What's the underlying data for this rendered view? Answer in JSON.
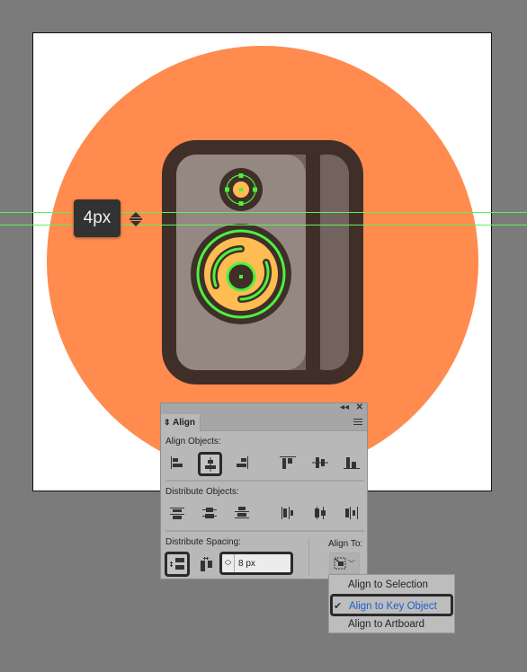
{
  "canvas": {
    "background_color": "#7b7b7b",
    "artboard_color": "#ffffff",
    "circle_color": "#ff8b4f",
    "guide_color": "#5ef25a"
  },
  "illustration": {
    "subject": "speaker",
    "outline_color": "#402f28",
    "front_color": "#958781",
    "side_color": "#73635f",
    "cone_color": "#ffbc52",
    "selection_color": "#4bf23e"
  },
  "measurement": {
    "label": "4px",
    "icon": "vertical-distance-icon"
  },
  "align_panel": {
    "collapse_icon": "double-chevron-left-icon",
    "close_icon": "close-icon",
    "tab_label": "Align",
    "tab_icon": "updown-arrows-icon",
    "menu_icon": "hamburger-menu-icon",
    "align_objects_label": "Align Objects:",
    "align_objects_buttons": [
      {
        "name": "horizontal-align-left",
        "selected": false
      },
      {
        "name": "horizontal-align-center",
        "selected": true
      },
      {
        "name": "horizontal-align-right",
        "selected": false
      },
      {
        "name": "vertical-align-top",
        "selected": false
      },
      {
        "name": "vertical-align-center",
        "selected": false
      },
      {
        "name": "vertical-align-bottom",
        "selected": false
      }
    ],
    "distribute_objects_label": "Distribute Objects:",
    "distribute_objects_buttons": [
      {
        "name": "vertical-distribute-top"
      },
      {
        "name": "vertical-distribute-center"
      },
      {
        "name": "vertical-distribute-bottom"
      },
      {
        "name": "horizontal-distribute-left"
      },
      {
        "name": "horizontal-distribute-center"
      },
      {
        "name": "horizontal-distribute-right"
      }
    ],
    "distribute_spacing_label": "Distribute Spacing:",
    "distribute_spacing_buttons": [
      {
        "name": "vertical-distribute-space",
        "selected": true
      },
      {
        "name": "horizontal-distribute-space",
        "selected": false
      }
    ],
    "spacing_value": "8 px",
    "align_to_label": "Align To:",
    "align_to_icon": "key-object-icon"
  },
  "align_to_dropdown": {
    "items": [
      {
        "label": "Align to Selection",
        "checked": false
      },
      {
        "label": "Align to Key Object",
        "checked": true
      },
      {
        "label": "Align to Artboard",
        "checked": false
      }
    ],
    "check_glyph": "✔"
  }
}
